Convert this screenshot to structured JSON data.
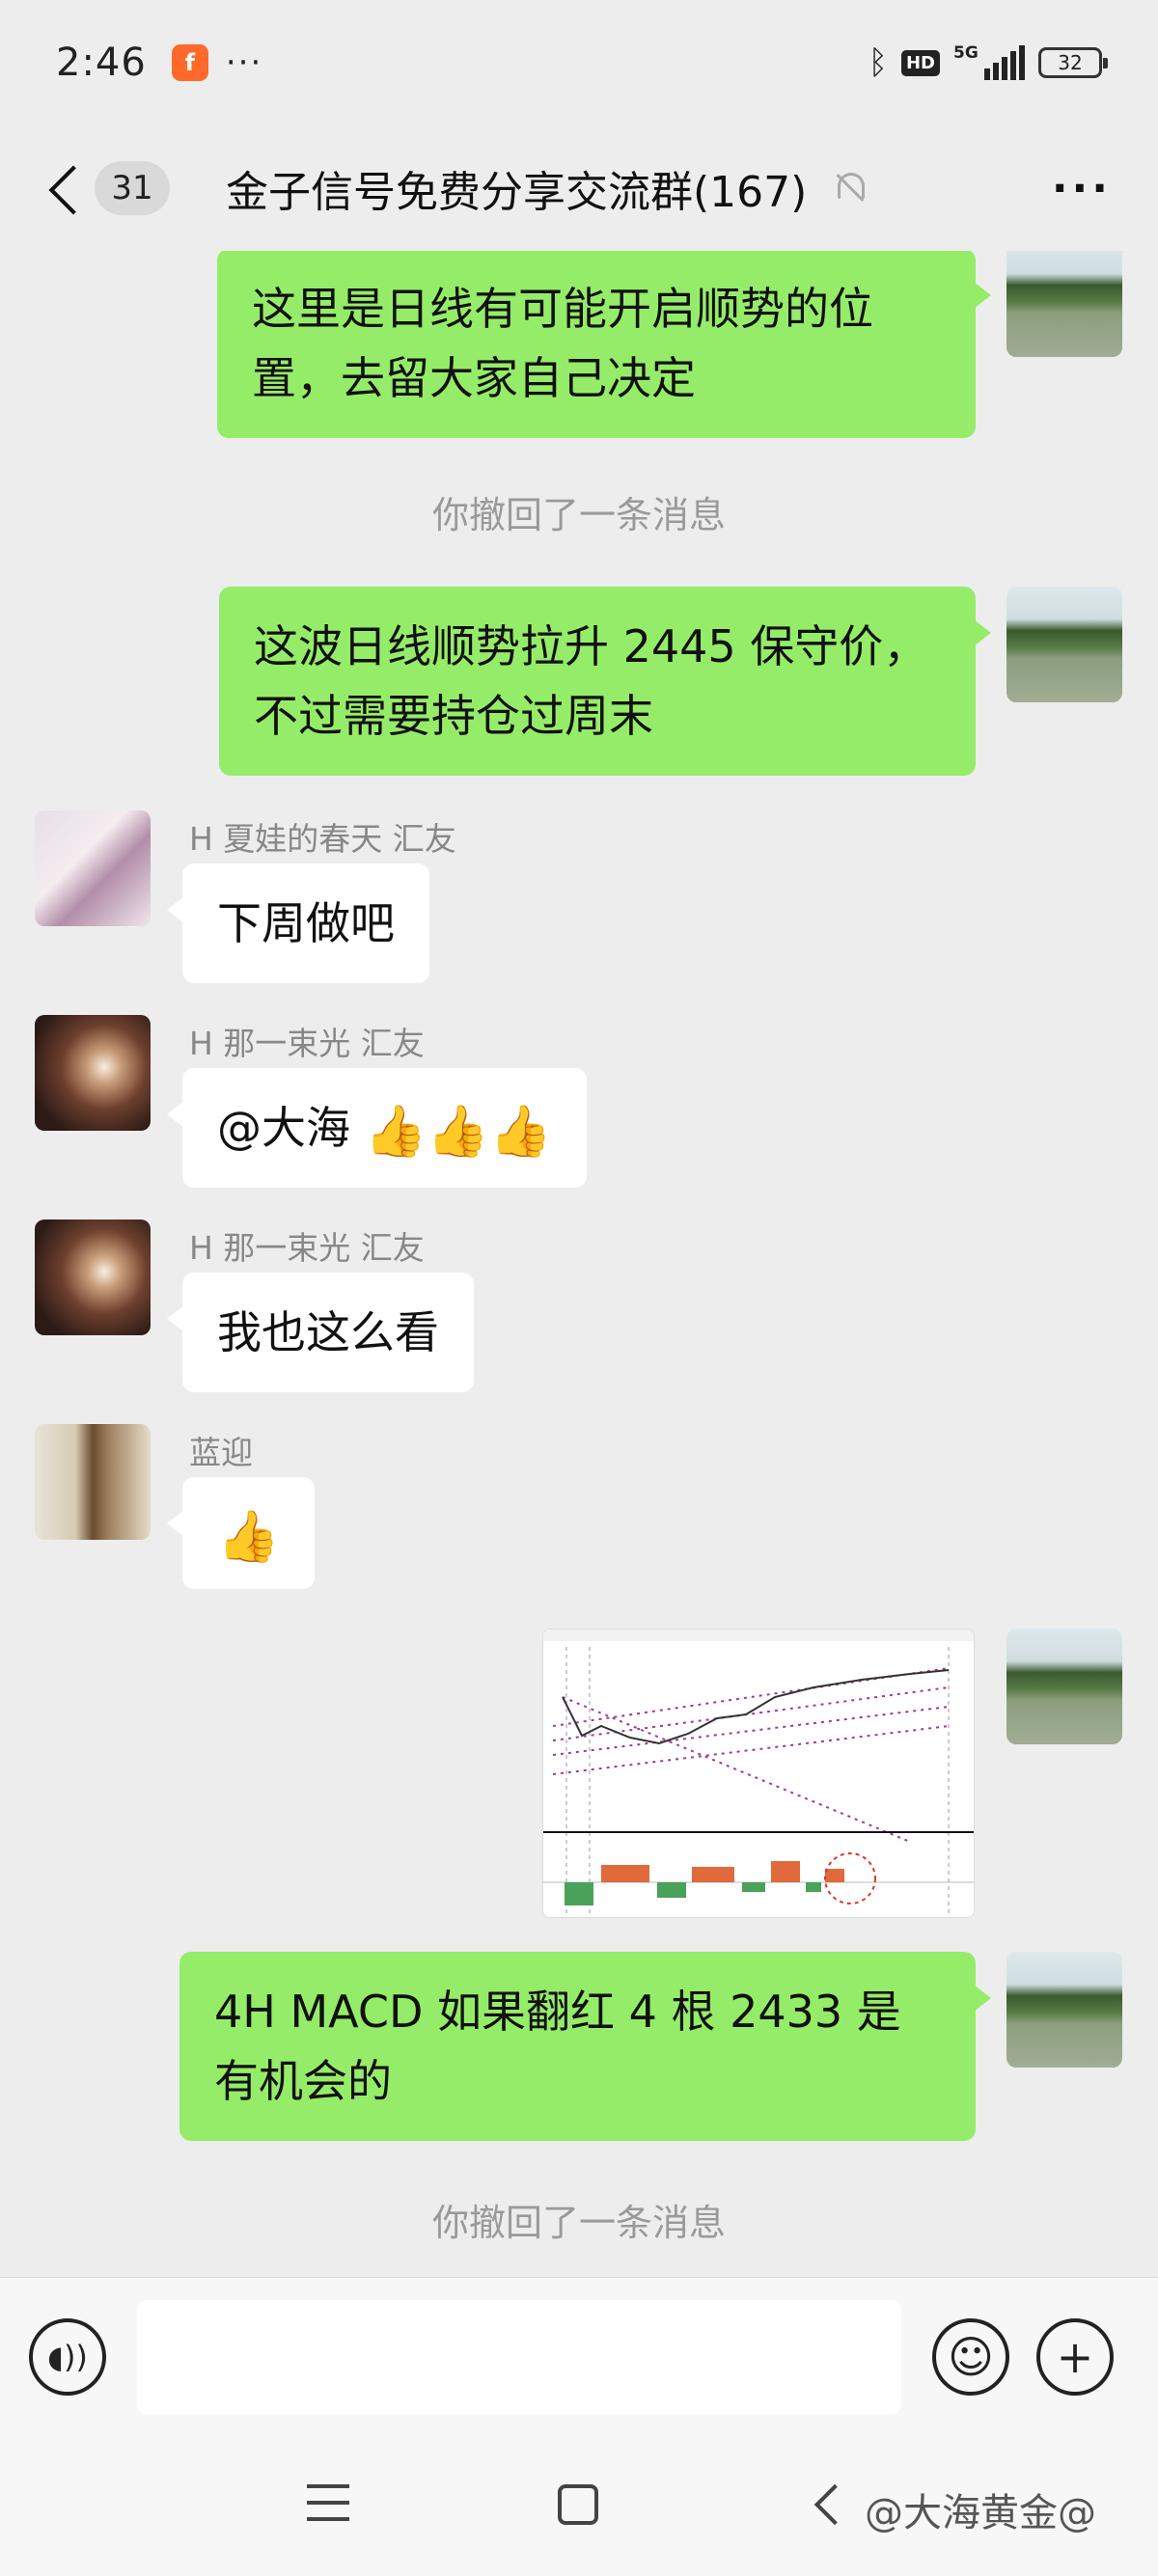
{
  "status_bar": {
    "time": "2:46",
    "app_icon_letter": "f",
    "more_dots": "···",
    "hd": "HD",
    "network": "5G",
    "battery": "32"
  },
  "title_bar": {
    "unread_count": "31",
    "title": "金子信号免费分享交流群(167)",
    "more": "···"
  },
  "messages": {
    "m1_text": "这里是日线有可能开启顺势的位置，去留大家自己决定",
    "recall1": "你撤回了一条消息",
    "m2_text": "这波日线顺势拉升 2445 保守价，不过需要持仓过周末",
    "m3_sender": "H 夏娃的春天 汇友",
    "m3_text": "下周做吧",
    "m4_sender": "H 那一束光 汇友",
    "m4_text": "@大海 ",
    "m4_emoji": "👍👍👍",
    "m5_sender": "H 那一束光 汇友",
    "m5_text": "我也这么看",
    "m6_sender": "蓝迎",
    "m6_emoji": "👍",
    "m8_text": "4H  MACD 如果翻红 4 根 2433 是有机会的",
    "recall2": "你撤回了一条消息"
  },
  "input_bar": {
    "emoji_glyph": "☺",
    "plus_glyph": "+"
  },
  "watermark": "@大海黄金@",
  "colors": {
    "background": "#ededed",
    "my_bubble": "#95ec69",
    "other_bubble": "#ffffff",
    "system_text": "#9a9a9a"
  }
}
